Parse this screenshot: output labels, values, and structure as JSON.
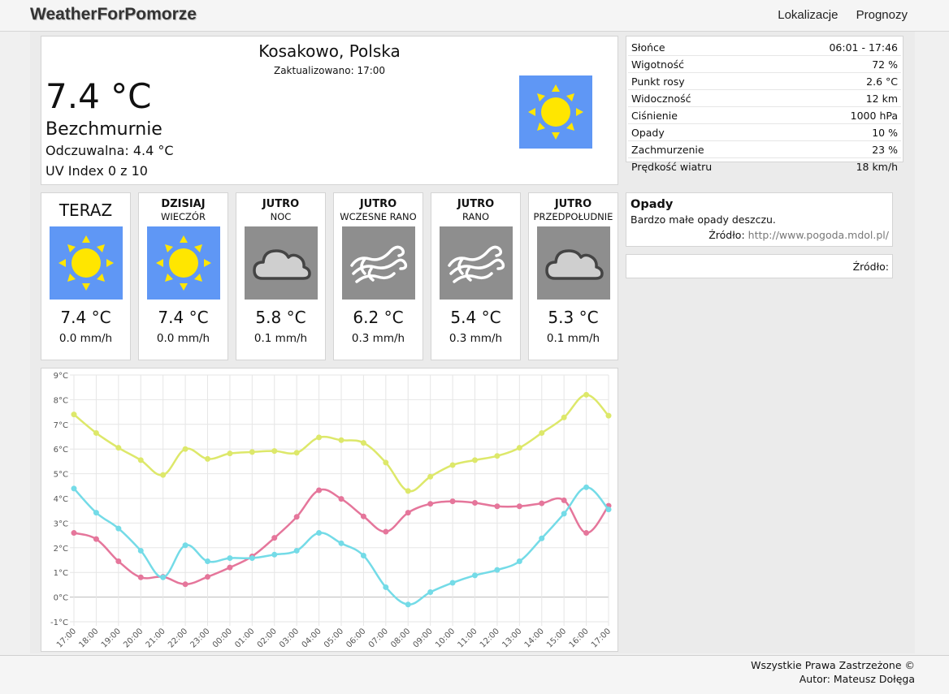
{
  "brand": "WeatherForPomorze",
  "nav": [
    "Lokalizacje",
    "Prognozy"
  ],
  "current": {
    "city": "Kosakowo, Polska",
    "updated": "Zaktualizowano: 17:00",
    "temp": "7.4 °C",
    "condition": "Bezchmurnie",
    "feels": "Odczuwalna: 4.4 °C",
    "uv": "UV Index 0 z 10",
    "icon": "sun-icon"
  },
  "details": [
    {
      "label": "Słońce",
      "value": "06:01 - 17:46"
    },
    {
      "label": "Wigotność",
      "value": "72 %"
    },
    {
      "label": "Punkt rosy",
      "value": "2.6 °C"
    },
    {
      "label": "Widoczność",
      "value": "12 km"
    },
    {
      "label": "Ciśnienie",
      "value": "1000 hPa"
    },
    {
      "label": "Opady",
      "value": "10 %"
    },
    {
      "label": "Zachmurzenie",
      "value": "23 %"
    },
    {
      "label": "Prędkość wiatru",
      "value": "18 km/h"
    }
  ],
  "forecast": [
    {
      "title": "TERAZ",
      "subtitle": "",
      "icon": "sun-icon",
      "temp": "7.4 °C",
      "rain": "0.0 mm/h"
    },
    {
      "title": "DZISIAJ",
      "subtitle": "WIECZÓR",
      "icon": "sun-icon",
      "temp": "7.4 °C",
      "rain": "0.0 mm/h"
    },
    {
      "title": "JUTRO",
      "subtitle": "NOC",
      "icon": "cloud-icon",
      "temp": "5.8 °C",
      "rain": "0.1 mm/h"
    },
    {
      "title": "JUTRO",
      "subtitle": "WCZESNE RANO",
      "icon": "wind-icon",
      "temp": "6.2 °C",
      "rain": "0.3 mm/h"
    },
    {
      "title": "JUTRO",
      "subtitle": "RANO",
      "icon": "wind-icon",
      "temp": "5.4 °C",
      "rain": "0.3 mm/h"
    },
    {
      "title": "JUTRO",
      "subtitle": "PRZEDPOŁUDNIE",
      "icon": "cloud-icon",
      "temp": "5.3 °C",
      "rain": "0.1 mm/h"
    }
  ],
  "precip": {
    "heading": "Opady",
    "desc": "Bardzo małe opady deszczu.",
    "source_label": "Źródło:",
    "source_link": "http://www.pogoda.mdol.pl/"
  },
  "source2": {
    "label": "Źródło:"
  },
  "footer": {
    "line1": "Wszystkie Prawa Zastrzeżone ©",
    "line2": "Autor: Mateusz Dołęga"
  },
  "colors": {
    "sunny_bg": "#5f97f5",
    "cloudy_bg": "#8e8e8e",
    "sun": "#ffe600"
  },
  "chart_data": {
    "type": "line",
    "ylim": [
      -1,
      9
    ],
    "yticks": [
      "-1°C",
      "0°C",
      "1°C",
      "2°C",
      "3°C",
      "4°C",
      "5°C",
      "6°C",
      "7°C",
      "8°C",
      "9°C"
    ],
    "categories": [
      "17:00",
      "18:00",
      "19:00",
      "20:00",
      "21:00",
      "22:00",
      "23:00",
      "00:00",
      "01:00",
      "02:00",
      "03:00",
      "04:00",
      "05:00",
      "06:00",
      "07:00",
      "08:00",
      "09:00",
      "10:00",
      "11:00",
      "12:00",
      "13:00",
      "14:00",
      "15:00",
      "16:00",
      "17:00"
    ],
    "grid": true,
    "series": [
      {
        "color": "#dde86a",
        "values": [
          7.4,
          6.65,
          6.05,
          5.55,
          4.95,
          6.0,
          5.6,
          5.82,
          5.88,
          5.92,
          5.85,
          6.47,
          6.36,
          6.25,
          5.45,
          4.3,
          4.88,
          5.35,
          5.55,
          5.72,
          6.05,
          6.65,
          7.28,
          8.2,
          7.35
        ]
      },
      {
        "color": "#e5769b",
        "values": [
          2.6,
          2.35,
          1.45,
          0.8,
          0.82,
          0.52,
          0.82,
          1.2,
          1.65,
          2.4,
          3.25,
          4.33,
          3.98,
          3.27,
          2.65,
          3.42,
          3.78,
          3.88,
          3.82,
          3.68,
          3.68,
          3.8,
          3.92,
          2.6,
          3.7
        ]
      },
      {
        "color": "#74dbe7",
        "values": [
          4.4,
          3.42,
          2.78,
          1.88,
          0.8,
          2.1,
          1.45,
          1.58,
          1.58,
          1.72,
          1.88,
          2.6,
          2.18,
          1.68,
          0.4,
          -0.3,
          0.2,
          0.58,
          0.88,
          1.1,
          1.45,
          2.38,
          3.38,
          4.45,
          3.55
        ]
      }
    ]
  }
}
